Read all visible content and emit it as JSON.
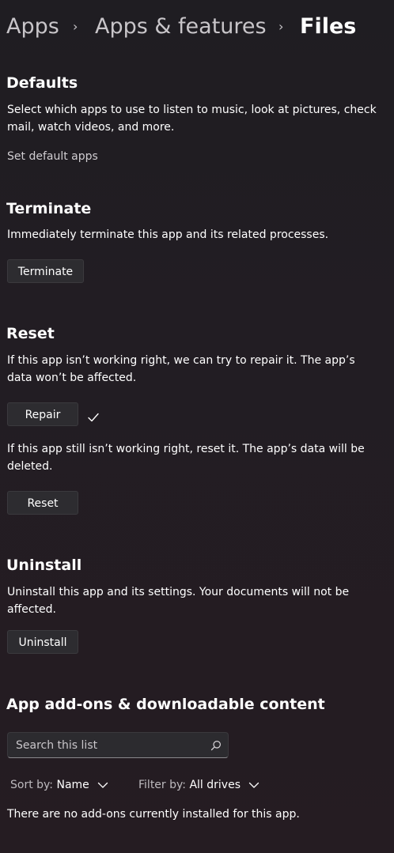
{
  "breadcrumb": {
    "items": [
      "Apps",
      "Apps & features"
    ],
    "current": "Files",
    "separator": "›"
  },
  "defaults": {
    "title": "Defaults",
    "description": "Select which apps to use to listen to music, look at pictures, check mail, watch videos, and more.",
    "link": "Set default apps"
  },
  "terminate": {
    "title": "Terminate",
    "description": "Immediately terminate this app and its related processes.",
    "button": "Terminate"
  },
  "reset": {
    "title": "Reset",
    "repair_description": "If this app isn’t working right, we can try to repair it. The app’s data won’t be affected.",
    "repair_button": "Repair",
    "repair_status_icon": "checkmark-icon",
    "reset_description": "If this app still isn’t working right, reset it. The app’s data will be deleted.",
    "reset_button": "Reset"
  },
  "uninstall": {
    "title": "Uninstall",
    "description": "Uninstall this app and its settings. Your documents will not be affected.",
    "button": "Uninstall"
  },
  "addons": {
    "title": "App add-ons & downloadable content",
    "search_placeholder": "Search this list",
    "search_value": "",
    "sort_label": "Sort by:",
    "sort_value": "Name",
    "filter_label": "Filter by:",
    "filter_value": "All drives",
    "empty_message": "There are no add-ons currently installed for this app."
  },
  "colors": {
    "background": "#221d23",
    "button_bg": "#2d2c30",
    "text": "#ffffff",
    "muted_text": "#c8c5c9"
  }
}
